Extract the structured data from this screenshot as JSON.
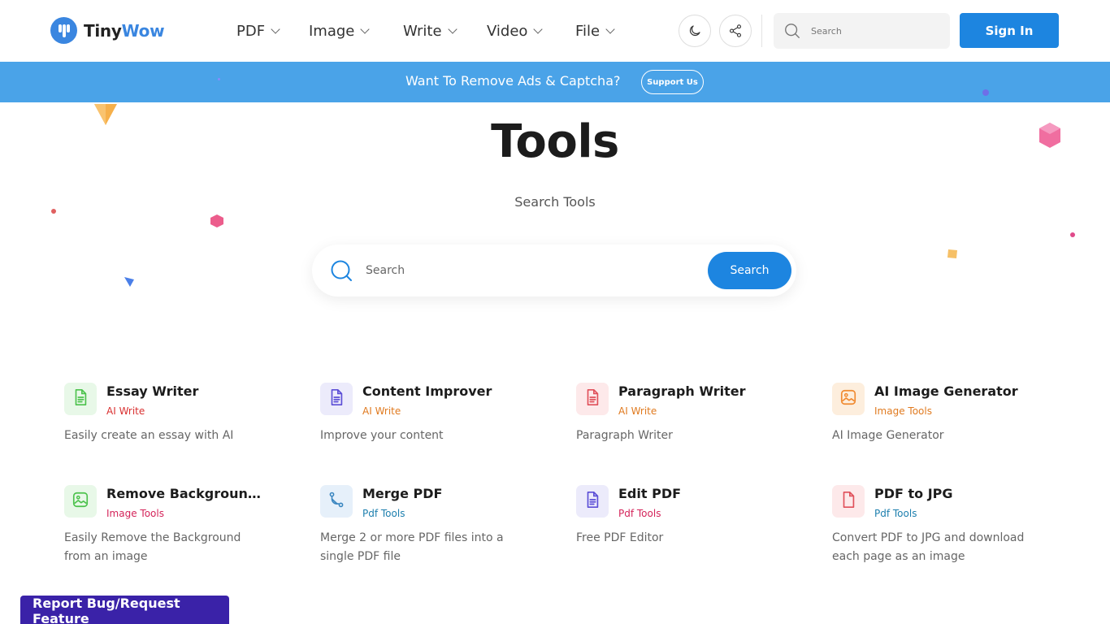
{
  "header": {
    "logo": {
      "part1": "Tiny",
      "part2": "Wow",
      "brand_color": "#3a86e0"
    },
    "nav": [
      {
        "label": "PDF"
      },
      {
        "label": "Image"
      },
      {
        "label": "Write"
      },
      {
        "label": "Video"
      },
      {
        "label": "File"
      }
    ],
    "theme_icon": "moon-icon",
    "share_icon": "share-icon",
    "search": {
      "placeholder": "Search"
    },
    "signin_label": "Sign In"
  },
  "banner": {
    "text": "Want To Remove Ads & Captcha?",
    "button_label": "Support Us",
    "color": "#4aa3e8"
  },
  "hero": {
    "title": "Tools",
    "subtitle": "Search Tools",
    "search": {
      "placeholder": "Search",
      "button_label": "Search"
    }
  },
  "tools": [
    {
      "name": "Essay Writer",
      "category": "AI Write",
      "category_color": "#d93030",
      "description": "Easily create an essay with AI",
      "icon": "document-icon",
      "icon_color": "#4cc24c",
      "icon_bg": "#e8f8e8"
    },
    {
      "name": "Content Improver",
      "category": "AI Write",
      "category_color": "#e07a1f",
      "description": "Improve your content",
      "icon": "document-icon",
      "icon_color": "#5b4ed6",
      "icon_bg": "#ecebfb"
    },
    {
      "name": "Paragraph Writer",
      "category": "AI Write",
      "category_color": "#e07a1f",
      "description": "Paragraph Writer",
      "icon": "document-icon",
      "icon_color": "#e0505a",
      "icon_bg": "#fde9ea"
    },
    {
      "name": "AI Image Generator",
      "category": "Image Tools",
      "category_color": "#e07a1f",
      "description": "AI Image Generator",
      "icon": "image-icon",
      "icon_color": "#f08a30",
      "icon_bg": "#fdeedd"
    },
    {
      "name": "Remove Background...",
      "category": "Image Tools",
      "category_color": "#d4245a",
      "description": "Easily Remove the Background from an image",
      "icon": "image-icon",
      "icon_color": "#4cc24c",
      "icon_bg": "#e8f8e8"
    },
    {
      "name": "Merge PDF",
      "category": "Pdf Tools",
      "category_color": "#1d7fae",
      "description": "Merge 2 or more PDF files into a single PDF file",
      "icon": "merge-icon",
      "icon_color": "#3a86c0",
      "icon_bg": "#e6f0fa"
    },
    {
      "name": "Edit PDF",
      "category": "Pdf Tools",
      "category_color": "#d4245a",
      "description": "Free PDF Editor",
      "icon": "document-icon",
      "icon_color": "#5b4ed6",
      "icon_bg": "#ecebfb"
    },
    {
      "name": "PDF to JPG",
      "category": "Pdf Tools",
      "category_color": "#1d7fae",
      "description": "Convert PDF to JPG and download each page as an image",
      "icon": "file-icon",
      "icon_color": "#e0505a",
      "icon_bg": "#fde9ea"
    }
  ],
  "report_label": "Report Bug/Request Feature"
}
